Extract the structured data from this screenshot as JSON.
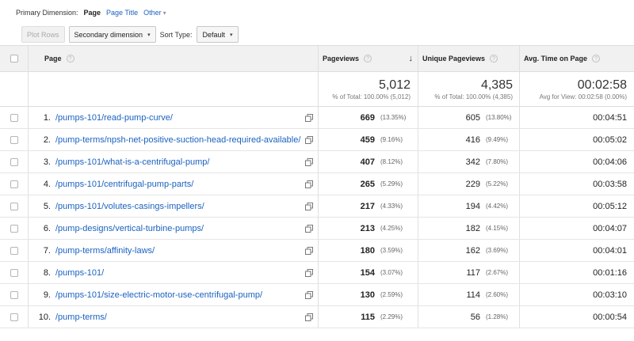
{
  "dimension_bar": {
    "label": "Primary Dimension:",
    "active": "Page",
    "option_page_title": "Page Title",
    "option_other": "Other",
    "other_caret": "▾"
  },
  "toolbar": {
    "plot_rows": "Plot Rows",
    "secondary_dimension": "Secondary dimension",
    "sort_type_label": "Sort Type:",
    "sort_type_value": "Default",
    "dropdown_caret": "▾"
  },
  "table": {
    "headers": {
      "page": "Page",
      "pageviews": "Pageviews",
      "unique_pageviews": "Unique Pageviews",
      "avg_time": "Avg. Time on Page",
      "help_glyph": "?",
      "sort_glyph": "↓"
    },
    "summary": {
      "pageviews": "5,012",
      "pageviews_sub": "% of Total: 100.00% (5,012)",
      "unique_pageviews": "4,385",
      "unique_pageviews_sub": "% of Total: 100.00% (4,385)",
      "avg_time": "00:02:58",
      "avg_time_sub": "Avg for View: 00:02:58 (0.00%)"
    },
    "rows": [
      {
        "rank": "1.",
        "page": "/pumps-101/read-pump-curve/",
        "pageviews": "669",
        "pv_pct": "(13.35%)",
        "unique": "605",
        "u_pct": "(13.80%)",
        "avg": "00:04:51"
      },
      {
        "rank": "2.",
        "page": "/pump-terms/npsh-net-positive-suction-head-required-available/",
        "pageviews": "459",
        "pv_pct": "(9.16%)",
        "unique": "416",
        "u_pct": "(9.49%)",
        "avg": "00:05:02"
      },
      {
        "rank": "3.",
        "page": "/pumps-101/what-is-a-centrifugal-pump/",
        "pageviews": "407",
        "pv_pct": "(8.12%)",
        "unique": "342",
        "u_pct": "(7.80%)",
        "avg": "00:04:06"
      },
      {
        "rank": "4.",
        "page": "/pumps-101/centrifugal-pump-parts/",
        "pageviews": "265",
        "pv_pct": "(5.29%)",
        "unique": "229",
        "u_pct": "(5.22%)",
        "avg": "00:03:58"
      },
      {
        "rank": "5.",
        "page": "/pumps-101/volutes-casings-impellers/",
        "pageviews": "217",
        "pv_pct": "(4.33%)",
        "unique": "194",
        "u_pct": "(4.42%)",
        "avg": "00:05:12"
      },
      {
        "rank": "6.",
        "page": "/pump-designs/vertical-turbine-pumps/",
        "pageviews": "213",
        "pv_pct": "(4.25%)",
        "unique": "182",
        "u_pct": "(4.15%)",
        "avg": "00:04:07"
      },
      {
        "rank": "7.",
        "page": "/pump-terms/affinity-laws/",
        "pageviews": "180",
        "pv_pct": "(3.59%)",
        "unique": "162",
        "u_pct": "(3.69%)",
        "avg": "00:04:01"
      },
      {
        "rank": "8.",
        "page": "/pumps-101/",
        "pageviews": "154",
        "pv_pct": "(3.07%)",
        "unique": "117",
        "u_pct": "(2.67%)",
        "avg": "00:01:16"
      },
      {
        "rank": "9.",
        "page": "/pumps-101/size-electric-motor-use-centrifugal-pump/",
        "pageviews": "130",
        "pv_pct": "(2.59%)",
        "unique": "114",
        "u_pct": "(2.60%)",
        "avg": "00:03:10"
      },
      {
        "rank": "10.",
        "page": "/pump-terms/",
        "pageviews": "115",
        "pv_pct": "(2.29%)",
        "unique": "56",
        "u_pct": "(1.28%)",
        "avg": "00:00:54"
      }
    ]
  },
  "colors": {
    "link": "#1a62c0",
    "header_bg": "#f1f1f1"
  }
}
